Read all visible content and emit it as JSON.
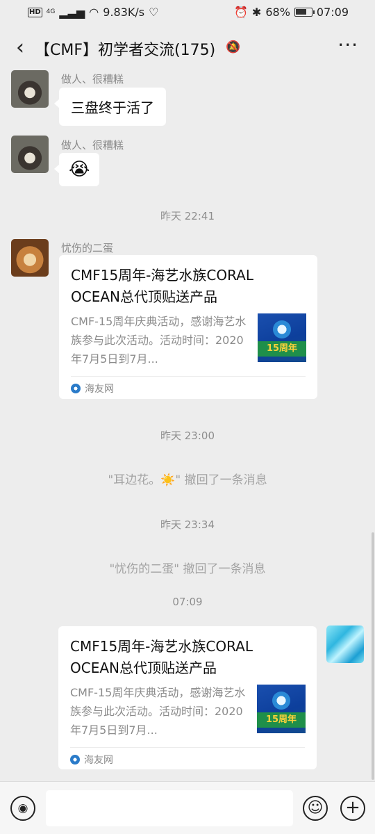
{
  "status_bar": {
    "hd": "HD",
    "network": "4G",
    "speed": "9.83K/s",
    "battery": "68%",
    "time": "07:09"
  },
  "header": {
    "title": "【CMF】初学者交流(175)"
  },
  "messages": [
    {
      "sender": "做人、很糟糕",
      "text": "三盘终于活了"
    },
    {
      "sender": "做人、很糟糕",
      "emoji": "😭"
    }
  ],
  "time_labels": [
    "昨天 22:41",
    "昨天 23:00",
    "昨天 23:34",
    "07:09"
  ],
  "link_card_1": {
    "sender": "忧伤的二蛋",
    "title": "CMF15周年-海艺水族CORAL OCEAN总代顶贴送产品",
    "description": "CMF-15周年庆典活动，感谢海艺水族参与此次活动。活动时间：2020年7月5日到7月...",
    "thumb_text": "15周年",
    "source": "海友网"
  },
  "recall_notices": [
    {
      "prefix": "\"耳边花。",
      "emoji": "☀️",
      "suffix": "\" 撤回了一条消息"
    },
    {
      "text": "\"忧伤的二蛋\" 撤回了一条消息"
    }
  ],
  "link_card_2": {
    "title": "CMF15周年-海艺水族CORAL OCEAN总代顶贴送产品",
    "description": "CMF-15周年庆典活动，感谢海艺水族参与此次活动。活动时间：2020年7月5日到7月...",
    "thumb_text": "15周年",
    "source": "海友网"
  },
  "icons": {
    "back": "back-arrow-icon",
    "mute": "mute-bell-icon",
    "more": "more-icon",
    "voice": "voice-icon",
    "emoji": "emoji-icon",
    "plus": "plus-icon"
  }
}
